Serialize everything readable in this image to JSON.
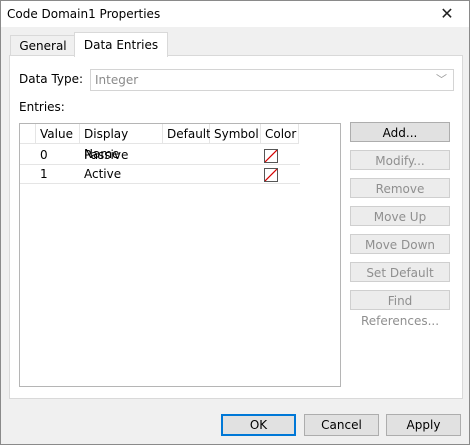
{
  "window": {
    "title": "Code Domain1 Properties",
    "close_glyph": "✕"
  },
  "tabs": [
    {
      "label": "General",
      "active": false
    },
    {
      "label": "Data Entries",
      "active": true
    }
  ],
  "data_type": {
    "label": "Data Type:",
    "value": "Integer"
  },
  "entries": {
    "label": "Entries:",
    "columns": [
      "Value",
      "Display Name",
      "Default",
      "Symbol",
      "Color"
    ],
    "rows": [
      {
        "value": "0",
        "display_name": "Passive",
        "default": "",
        "symbol": ""
      },
      {
        "value": "1",
        "display_name": "Active",
        "default": "",
        "symbol": ""
      }
    ]
  },
  "side_buttons": [
    {
      "label": "Add...",
      "enabled": true
    },
    {
      "label": "Modify...",
      "enabled": false
    },
    {
      "label": "Remove",
      "enabled": false
    },
    {
      "label": "Move Up",
      "enabled": false
    },
    {
      "label": "Move Down",
      "enabled": false
    },
    {
      "label": "Set Default",
      "enabled": false
    },
    {
      "label": "Find References...",
      "enabled": false
    }
  ],
  "footer": {
    "ok": "OK",
    "cancel": "Cancel",
    "apply": "Apply"
  }
}
